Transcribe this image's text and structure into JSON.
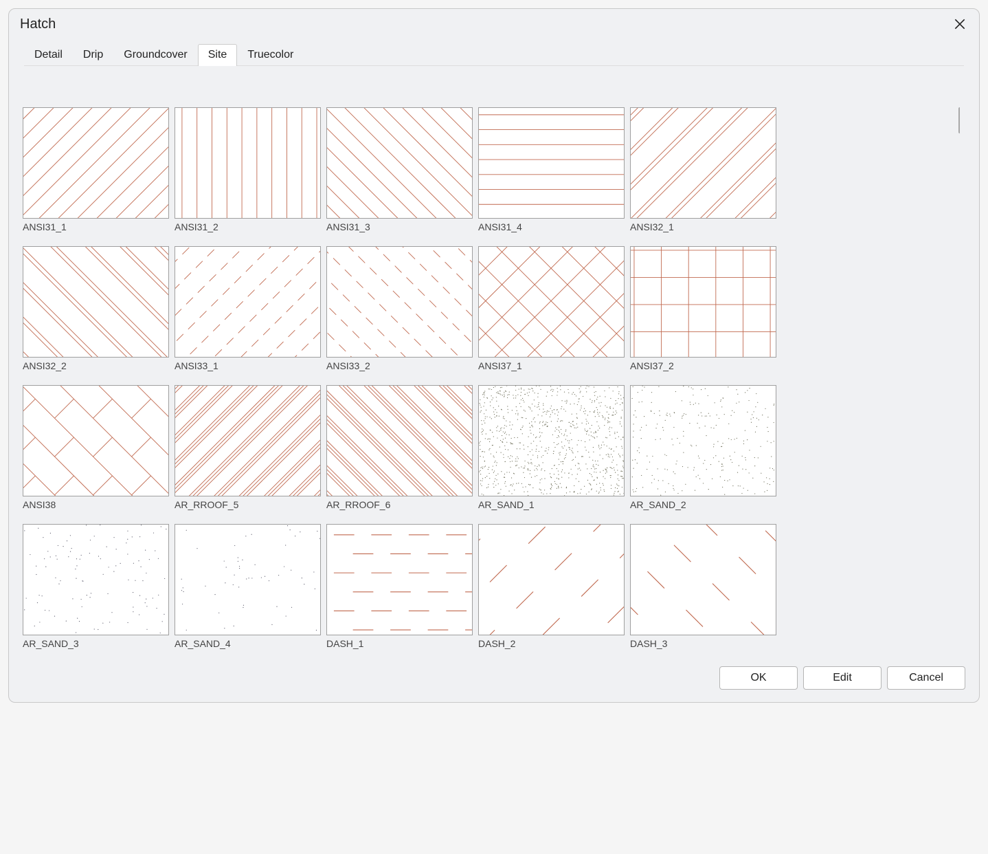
{
  "window": {
    "title": "Hatch"
  },
  "tabs": {
    "items": [
      {
        "label": "Detail"
      },
      {
        "label": "Drip"
      },
      {
        "label": "Groundcover"
      },
      {
        "label": "Site"
      },
      {
        "label": "Truecolor"
      }
    ],
    "active_index": 3
  },
  "patterns": [
    {
      "name": "ANSI31_1",
      "style": "diag45"
    },
    {
      "name": "ANSI31_2",
      "style": "vertical"
    },
    {
      "name": "ANSI31_3",
      "style": "diag135"
    },
    {
      "name": "ANSI31_4",
      "style": "horizontal"
    },
    {
      "name": "ANSI32_1",
      "style": "diag45_double"
    },
    {
      "name": "ANSI32_2",
      "style": "diag135_double"
    },
    {
      "name": "ANSI33_1",
      "style": "diag45_dashed"
    },
    {
      "name": "ANSI33_2",
      "style": "diag135_dashed"
    },
    {
      "name": "ANSI37_1",
      "style": "crosshatch_diag"
    },
    {
      "name": "ANSI37_2",
      "style": "grid"
    },
    {
      "name": "ANSI38",
      "style": "brick_diag"
    },
    {
      "name": "AR_RROOF_5",
      "style": "diag45_triple"
    },
    {
      "name": "AR_RROOF_6",
      "style": "diag135_triple"
    },
    {
      "name": "AR_SAND_1",
      "style": "sand_dense"
    },
    {
      "name": "AR_SAND_2",
      "style": "sand_med"
    },
    {
      "name": "AR_SAND_3",
      "style": "sand_sparse"
    },
    {
      "name": "AR_SAND_4",
      "style": "sand_vsparse"
    },
    {
      "name": "DASH_1",
      "style": "dash_h"
    },
    {
      "name": "DASH_2",
      "style": "dash_diag45"
    },
    {
      "name": "DASH_3",
      "style": "dash_diag135"
    }
  ],
  "hatch_color": "#c0694f",
  "footer": {
    "ok": "OK",
    "edit": "Edit",
    "cancel": "Cancel"
  }
}
